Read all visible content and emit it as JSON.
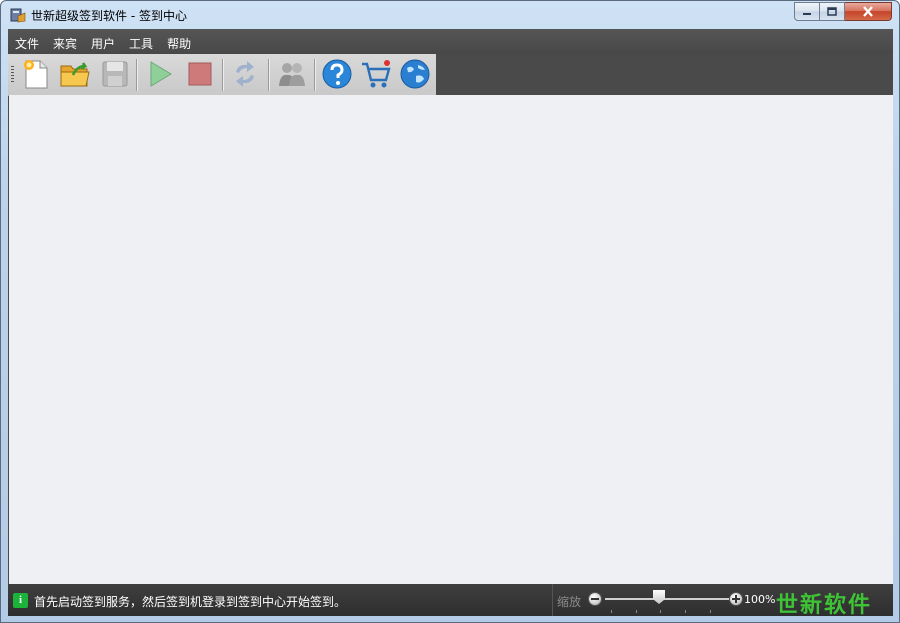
{
  "window": {
    "title": "世新超级签到软件 - 签到中心"
  },
  "menubar": {
    "items": [
      {
        "label": "文件"
      },
      {
        "label": "来宾"
      },
      {
        "label": "用户"
      },
      {
        "label": "工具"
      },
      {
        "label": "帮助"
      }
    ]
  },
  "toolbar": {
    "buttons": [
      {
        "icon": "new-document-icon"
      },
      {
        "icon": "open-folder-icon"
      },
      {
        "icon": "save-icon",
        "disabled": true
      },
      {
        "icon": "play-icon",
        "disabled": true
      },
      {
        "icon": "stop-icon",
        "disabled": true
      },
      {
        "icon": "refresh-icon",
        "disabled": true
      },
      {
        "icon": "users-icon",
        "disabled": true
      },
      {
        "icon": "help-icon"
      },
      {
        "icon": "shopping-cart-icon"
      },
      {
        "icon": "globe-icon"
      }
    ]
  },
  "statusbar": {
    "message": "首先启动签到服务，然后签到机登录到签到中心开始签到。",
    "zoom_label": "缩放",
    "zoom_value": "100%",
    "brand": "世新软件"
  },
  "colors": {
    "menubar_bg": "#4a4a4a",
    "canvas_bg": "#eff0f3",
    "brand_green": "#3ec236",
    "info_green": "#1bb33a"
  }
}
